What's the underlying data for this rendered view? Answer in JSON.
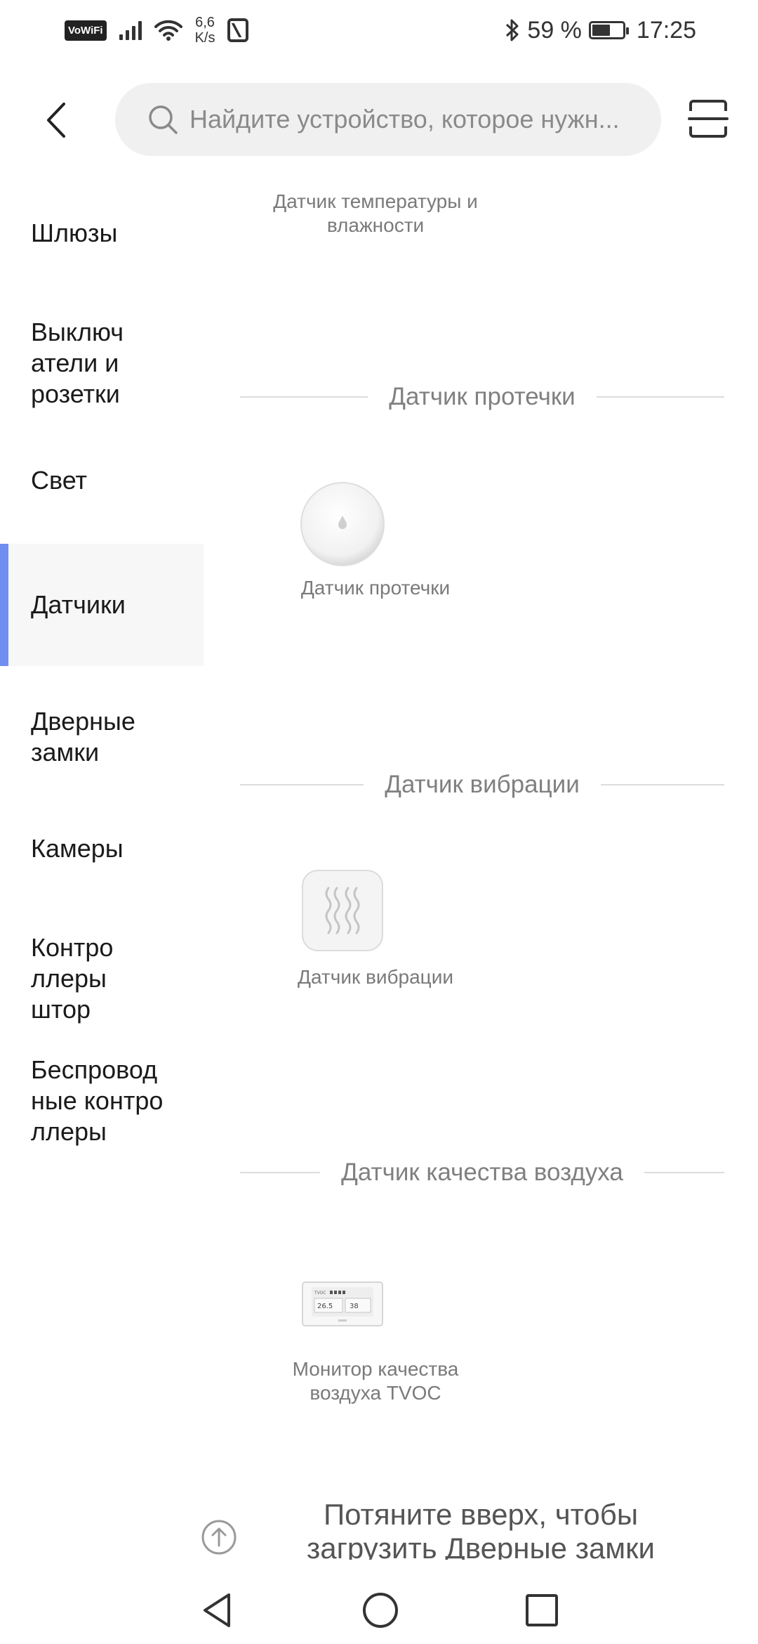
{
  "status_bar": {
    "vowifi": "VoWiFi",
    "net_speed_value": "6,6",
    "net_speed_unit": "K/s",
    "battery_percent": "59 %",
    "battery_level": 0.59,
    "time": "17:25"
  },
  "header": {
    "back_icon": "chevron-left-icon",
    "search_placeholder": "Найдите устройство, которое нужн...",
    "search_icon": "search-icon",
    "scan_icon": "scan-icon"
  },
  "sidebar": {
    "items": [
      {
        "label": "Шлюзы"
      },
      {
        "label": "Выключ\nатели и\nрозетки"
      },
      {
        "label": "Свет"
      },
      {
        "label": "Датчики",
        "active": true
      },
      {
        "label": "Дверные\nзамки"
      },
      {
        "label": "Камеры"
      },
      {
        "label": "Контро\nллеры\nштор"
      },
      {
        "label": "Беспровод\nные контро\nллеры"
      }
    ],
    "accent_color": "#6f8ef0"
  },
  "content": {
    "top_product": {
      "label": "Датчик температуры и\nвлажности"
    },
    "sections": [
      {
        "title": "Датчик протечки",
        "product": {
          "label": "Датчик протечки",
          "icon": "water-leak-sensor-icon"
        }
      },
      {
        "title": "Датчик вибрации",
        "product": {
          "label": "Датчик вибрации",
          "icon": "vibration-sensor-icon"
        }
      },
      {
        "title": "Датчик качества воздуха",
        "product": {
          "label": "Монитор качества\nвоздуха TVOC",
          "icon": "air-quality-monitor-icon",
          "screen_temp": "26.5",
          "screen_hum": "38",
          "screen_tag": "TVOC"
        }
      }
    ]
  },
  "footer": {
    "scroll_up_icon": "arrow-up-circle-icon",
    "pull_text": "Потяните вверх, чтобы загрузить Дверные замки"
  },
  "nav": {
    "back": "triangle-back-icon",
    "home": "circle-home-icon",
    "recents": "square-recents-icon"
  }
}
